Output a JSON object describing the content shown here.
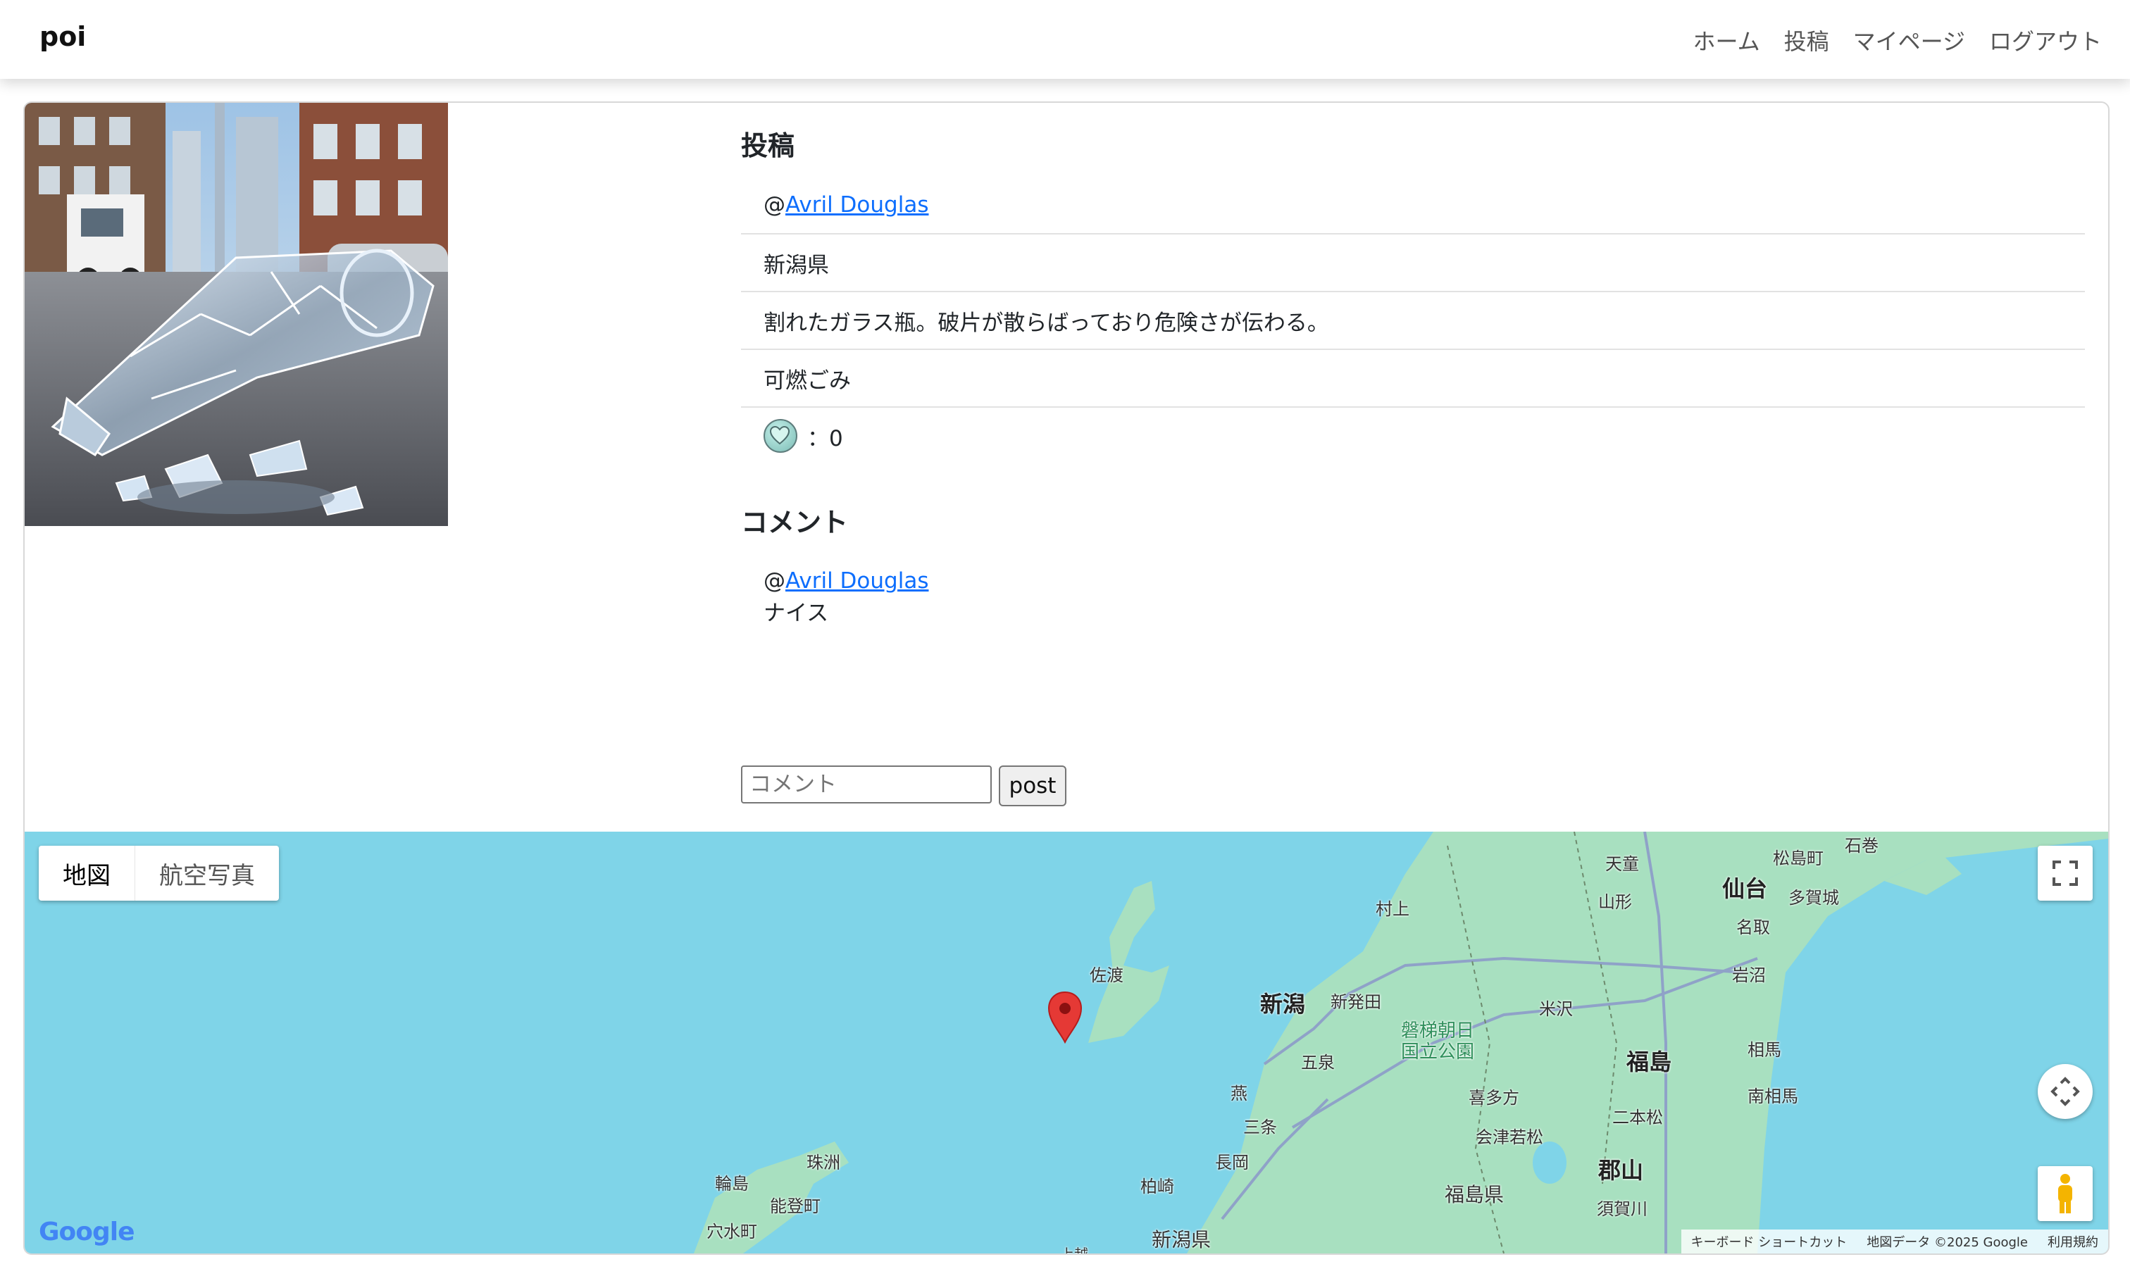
{
  "navbar": {
    "brand": "poi",
    "links": [
      "ホーム",
      "投稿",
      "マイページ",
      "ログアウト"
    ]
  },
  "post": {
    "section_title": "投稿",
    "user_prefix": "@",
    "user_name": "Avril Douglas",
    "prefecture": "新潟県",
    "description": "割れたガラス瓶。破片が散らばっており危険さが伝わる。",
    "category": "可燃ごみ",
    "likes_label": "：0"
  },
  "comments": {
    "section_title": "コメント",
    "items": [
      {
        "prefix": "@",
        "user": "Avril Douglas",
        "text": "ナイス"
      }
    ],
    "input_placeholder": "コメント",
    "submit_label": "post"
  },
  "map": {
    "type_options": [
      "地図",
      "航空写真"
    ],
    "selected_type": "地図",
    "labels": {
      "sado": "佐渡",
      "niigata": "新潟",
      "shibata": "新発田",
      "murakami": "村上",
      "gosen": "五泉",
      "tsubame": "燕",
      "sanjo": "三条",
      "nagaoka": "長岡",
      "kashiwazaki": "柏崎",
      "niigata_pref": "新潟県",
      "bandai": "磐梯朝日\n国立公園",
      "kitakata": "喜多方",
      "aizu": "会津若松",
      "fukushima_pref": "福島県",
      "yonezawa": "米沢",
      "fukushima": "福島",
      "nihonmatsu": "二本松",
      "koriyama": "郡山",
      "sukagawa": "須賀川",
      "soma": "相馬",
      "minamisoma": "南相馬",
      "iwanuma": "岩沼",
      "natori": "名取",
      "sendai": "仙台",
      "tagajo": "多賀城",
      "matsushima": "松島町",
      "ishinomaki": "石巻",
      "tendo": "天童",
      "yamagata": "山形",
      "wajima": "輪島",
      "suzu": "珠洲",
      "noto": "能登町",
      "anamizu": "穴水町",
      "joetsu": "上越"
    },
    "attribution": [
      "キーボード ショートカット",
      "地図データ ©2025 Google",
      "利用規約"
    ],
    "logo": "Google"
  },
  "colors": {
    "link": "#0d6efd",
    "water": "#7fd4e8",
    "land": "#a8e0c0",
    "marker": "#e53935"
  }
}
